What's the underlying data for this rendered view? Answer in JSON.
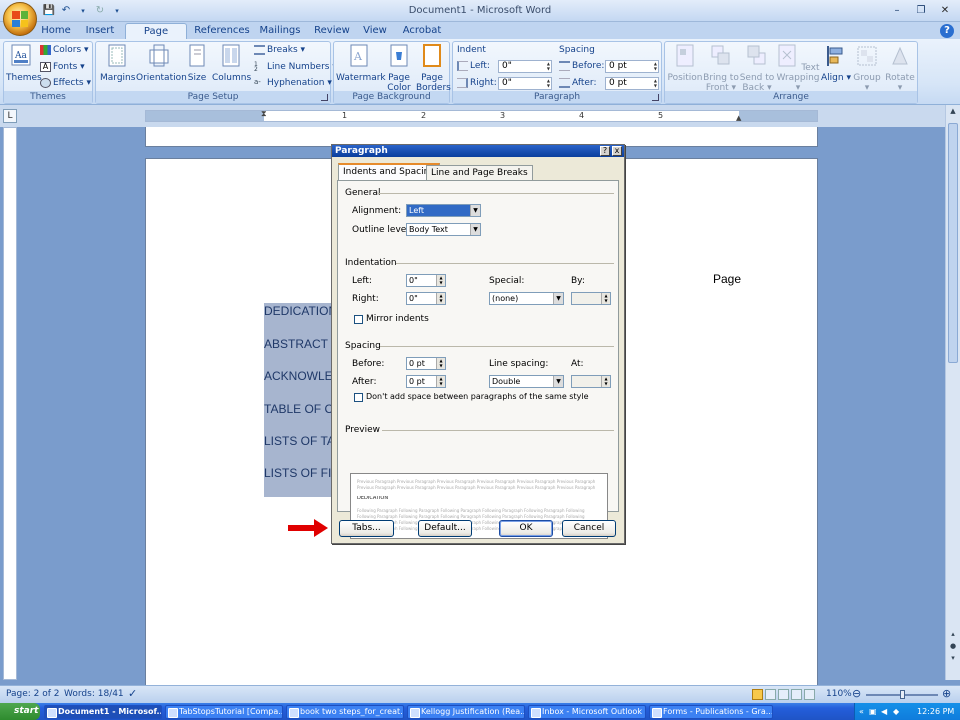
{
  "window": {
    "title": "Document1 - Microsoft Word"
  },
  "quick_access": [
    "save-icon",
    "undo-icon",
    "redo-icon",
    "customize-icon"
  ],
  "tabs": [
    "Home",
    "Insert",
    "Page Layout",
    "References",
    "Mailings",
    "Review",
    "View",
    "Acrobat"
  ],
  "active_tab": "Page Layout",
  "ribbon": {
    "themes": {
      "group": "Themes",
      "themes_label": "Themes",
      "colors": "Colors",
      "fonts": "Fonts",
      "effects": "Effects"
    },
    "page_setup": {
      "group": "Page Setup",
      "margins": "Margins",
      "orientation": "Orientation",
      "size": "Size",
      "columns": "Columns",
      "breaks": "Breaks",
      "line_numbers": "Line Numbers",
      "hyphenation": "Hyphenation"
    },
    "page_background": {
      "group": "Page Background",
      "watermark": "Watermark",
      "page_color_1": "Page",
      "page_color_2": "Color",
      "page_borders_1": "Page",
      "page_borders_2": "Borders"
    },
    "paragraph": {
      "group": "Paragraph",
      "indent": "Indent",
      "left_label": "Left:",
      "left_value": "0\"",
      "right_label": "Right:",
      "right_value": "0\"",
      "spacing": "Spacing",
      "before_label": "Before:",
      "before_value": "0 pt",
      "after_label": "After:",
      "after_value": "0 pt"
    },
    "arrange": {
      "group": "Arrange",
      "position": "Position",
      "bring_1": "Bring to",
      "bring_2": "Front",
      "send_1": "Send to",
      "send_2": "Back",
      "wrap_1": "Text",
      "wrap_2": "Wrapping",
      "align": "Align",
      "group_btn": "Group",
      "rotate": "Rotate"
    }
  },
  "ruler_numbers": [
    "1",
    "2",
    "3",
    "4",
    "5"
  ],
  "document": {
    "lines": [
      "DEDICATION",
      "ABSTRACT",
      "ACKNOWLEDGMENTS",
      "TABLE OF CONTENTS",
      "LISTS OF TABLES",
      "LISTS OF FIGURES"
    ],
    "page_word": "Page"
  },
  "dialog": {
    "title": "Paragraph",
    "tabs": [
      "Indents and Spacing",
      "Line and Page Breaks"
    ],
    "general": {
      "heading": "General",
      "alignment_label": "Alignment:",
      "alignment_value": "Left",
      "outline_label": "Outline level:",
      "outline_value": "Body Text"
    },
    "indentation": {
      "heading": "Indentation",
      "left_label": "Left:",
      "left_value": "0\"",
      "right_label": "Right:",
      "right_value": "0\"",
      "special_label": "Special:",
      "special_value": "(none)",
      "by_label": "By:",
      "by_value": "",
      "mirror": "Mirror indents"
    },
    "spacing": {
      "heading": "Spacing",
      "before_label": "Before:",
      "before_value": "0 pt",
      "after_label": "After:",
      "after_value": "0 pt",
      "line_label": "Line spacing:",
      "line_value": "Double",
      "at_label": "At:",
      "at_value": "",
      "dont_add": "Don't add space between paragraphs of the same style"
    },
    "preview": {
      "heading": "Preview",
      "prev_text": "Previous Paragraph Previous Paragraph Previous Paragraph Previous Paragraph Previous Paragraph Previous Paragraph",
      "sample_text": "DEDICATION",
      "follow_text": "Following Paragraph Following Paragraph Following Paragraph Following Paragraph Following Paragraph Following"
    },
    "buttons": {
      "tabs": "Tabs...",
      "default": "Default...",
      "ok": "OK",
      "cancel": "Cancel"
    }
  },
  "status": {
    "page": "Page: 2 of 2",
    "words": "Words: 18/41",
    "zoom": "110%"
  },
  "taskbar": {
    "start": "start",
    "items": [
      "Document1 - Microsof...",
      "TabStopsTutorial [Compa...",
      "book two steps_for_creat...",
      "Kellogg Justification (Rea...",
      "Inbox - Microsoft Outlook",
      "Forms - Publications - Gra..."
    ],
    "clock": "12:26 PM"
  },
  "colors": {
    "accent_arrow": "#e00000",
    "selection": "#a7b5cf",
    "ribbon": "#dbe8f7"
  }
}
